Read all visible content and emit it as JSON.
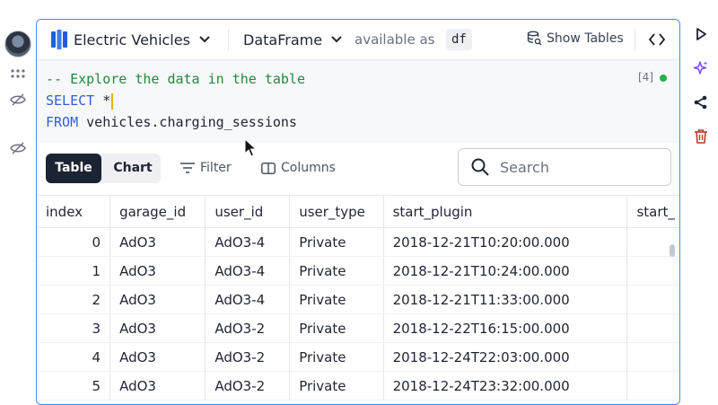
{
  "colors": {
    "accent": "#4a86f0",
    "comment": "#1f8a3b",
    "keyword": "#2f5fd0",
    "status_ok": "#22b04b",
    "segment_active": "#1c2333",
    "ai_icon": "#7c4dff",
    "delete_icon": "#c0392b"
  },
  "gutter": {
    "avatar_icon": "user-avatar-icon",
    "grid_icon": "grid-dots-icon",
    "hide_icon": "eye-off-icon"
  },
  "cell": {
    "source": {
      "name": "Electric Vehicles",
      "icon": "database-icon"
    },
    "mode": {
      "name": "DataFrame"
    },
    "available_as_label": "available as",
    "variable_name": "df",
    "show_tables_label": "Show Tables",
    "code_toggle_icon": "code-brackets-icon",
    "editor": {
      "lines": [
        {
          "text": "-- Explore the data in the table"
        },
        {
          "kw": "SELECT",
          "rest": " *"
        },
        {
          "kw": "FROM",
          "rest": " vehicles.charging_sessions"
        }
      ],
      "exec_count": "[4]"
    },
    "results": {
      "view_tabs": [
        "Table",
        "Chart"
      ],
      "active_view": "Table",
      "filter_label": "Filter",
      "columns_label": "Columns",
      "search_placeholder": "Search"
    },
    "table": {
      "columns": [
        "index",
        "garage_id",
        "user_id",
        "user_type",
        "start_plugin",
        "start_"
      ],
      "rows": [
        [
          "0",
          "AdO3",
          "AdO3-4",
          "Private",
          "2018-12-21T10:20:00.000",
          ""
        ],
        [
          "1",
          "AdO3",
          "AdO3-4",
          "Private",
          "2018-12-21T10:24:00.000",
          ""
        ],
        [
          "2",
          "AdO3",
          "AdO3-4",
          "Private",
          "2018-12-21T11:33:00.000",
          ""
        ],
        [
          "3",
          "AdO3",
          "AdO3-2",
          "Private",
          "2018-12-22T16:15:00.000",
          ""
        ],
        [
          "4",
          "AdO3",
          "AdO3-2",
          "Private",
          "2018-12-24T22:03:00.000",
          ""
        ],
        [
          "5",
          "AdO3",
          "AdO3-2",
          "Private",
          "2018-12-24T23:32:00.000",
          ""
        ]
      ]
    }
  },
  "right_rail": {
    "run_icon": "play-icon",
    "ai_icon": "sparkle-icon",
    "share_icon": "share-icon",
    "delete_icon": "trash-icon"
  }
}
